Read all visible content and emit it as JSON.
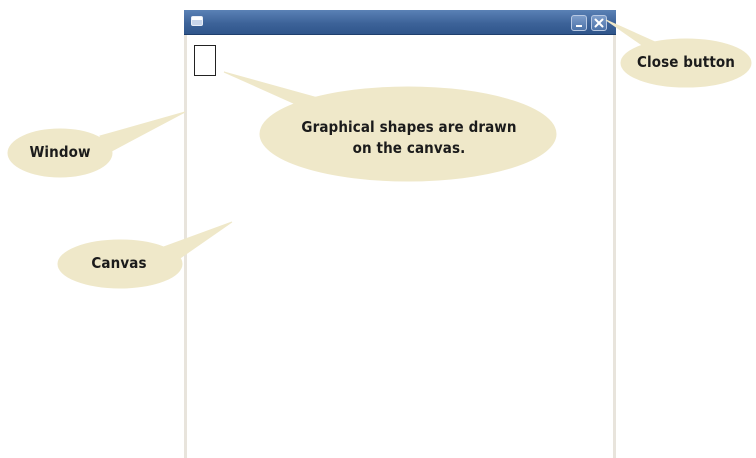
{
  "window": {
    "title_icon": "window-app-icon",
    "buttons": {
      "minimize": "minimize-icon",
      "close": "close-icon"
    }
  },
  "canvas": {
    "shapes": [
      {
        "type": "rectangle",
        "stroke": "#222222",
        "fill": "#ffffff"
      }
    ]
  },
  "callouts": {
    "close_button": "Close button",
    "shapes_line1": "Graphical shapes are drawn",
    "shapes_line2": "on the canvas.",
    "window": "Window",
    "canvas": "Canvas"
  },
  "colors": {
    "titlebar": "#3d6399",
    "callout_fill": "#efe8c9",
    "window_frame": "#e8e4dc"
  }
}
